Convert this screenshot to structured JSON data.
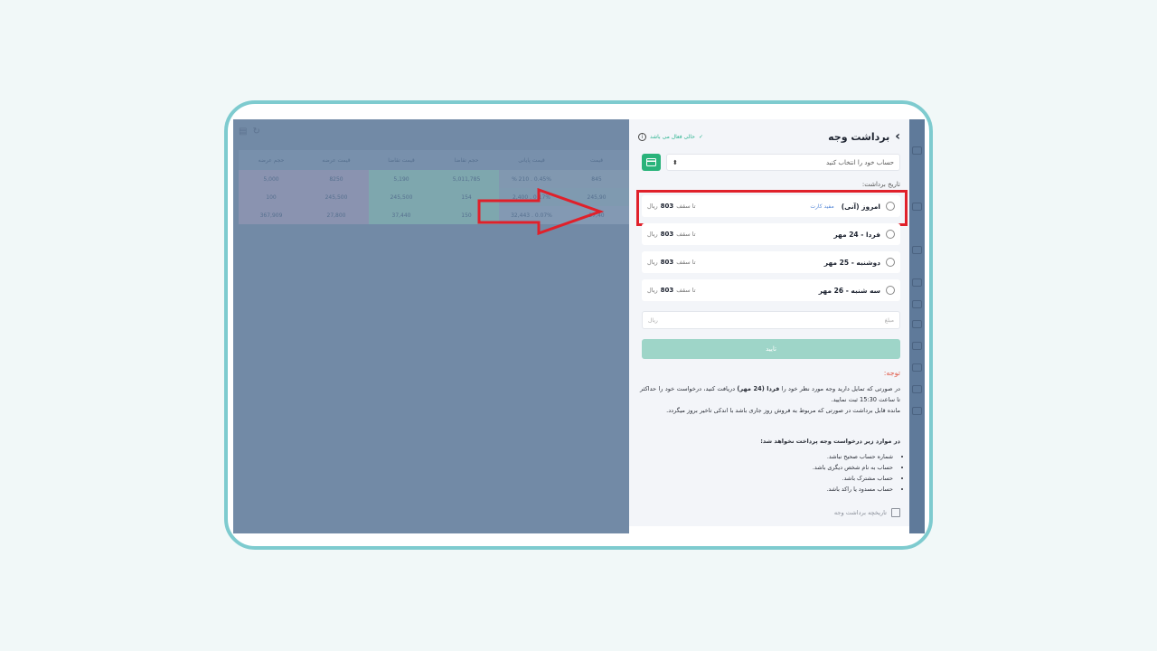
{
  "background_app": {
    "columns": [
      "حجم عرضه",
      "قیمت عرضه",
      "قیمت تقاضا",
      "حجم تقاضا",
      "قیمت پایانی",
      "قیمت"
    ],
    "rows": [
      [
        "5,000",
        "8250",
        "5,190",
        "5,011,785",
        "% 210 . 0.45%",
        "845"
      ],
      [
        "100",
        "245,500",
        "245,500",
        "154",
        "2,400 . 0.17%",
        "245,90"
      ],
      [
        "367,909",
        "27,800",
        "37,440",
        "150",
        "32,443 . 0.07%",
        "37,40"
      ]
    ]
  },
  "panel": {
    "title": "برداشت وجه",
    "status": "حالی فعال می باشد",
    "account_placeholder": "حساب خود را انتخاب کنید",
    "date_label": "تاریخ برداشت:",
    "options": [
      {
        "name": "امروز (آنی)",
        "tag": "مفید کارت",
        "limit_prefix": "تا سقف",
        "limit_value": "803",
        "limit_unit": "ریال"
      },
      {
        "name": "فردا - 24 مهر",
        "tag": "",
        "limit_prefix": "تا سقف",
        "limit_value": "803",
        "limit_unit": "ریال"
      },
      {
        "name": "دوشنبه - 25 مهر",
        "tag": "",
        "limit_prefix": "تا سقف",
        "limit_value": "803",
        "limit_unit": "ریال"
      },
      {
        "name": "سه شنبه - 26 مهر",
        "tag": "",
        "limit_prefix": "تا سقف",
        "limit_value": "803",
        "limit_unit": "ریال"
      }
    ],
    "amount_placeholder": "مبلغ",
    "amount_unit": "ریال",
    "confirm_label": "تایید",
    "note_title": "توجه:",
    "note_1_before": "در صورتی که تمایل دارید وجه مورد نظر خود را",
    "note_1_bold": "فردا (24 مهر)",
    "note_1_after": "دریافت کنید، درخواست خود را حداکثر تا ساعت 15:30 ثبت نمایید.",
    "note_2": "مانده قابل برداشت در صورتی که مربوط به فروش روز جاری باشد با اندکی تاخیر بروز میگردد.",
    "reject_title": "در موارد زیر درخواست وجه پرداخت نخواهد شد:",
    "reject_items": [
      "شماره حساب صحیح نباشد.",
      "حساب به نام شخص دیگری باشد.",
      "حساب مشترک باشد.",
      "حساب مسدود یا راکد باشد."
    ],
    "history_label": "تاریخچه برداشت وجه"
  },
  "colors": {
    "highlight": "#e0202a",
    "arrow": "#e0202a",
    "accent_green": "#29b37a"
  }
}
